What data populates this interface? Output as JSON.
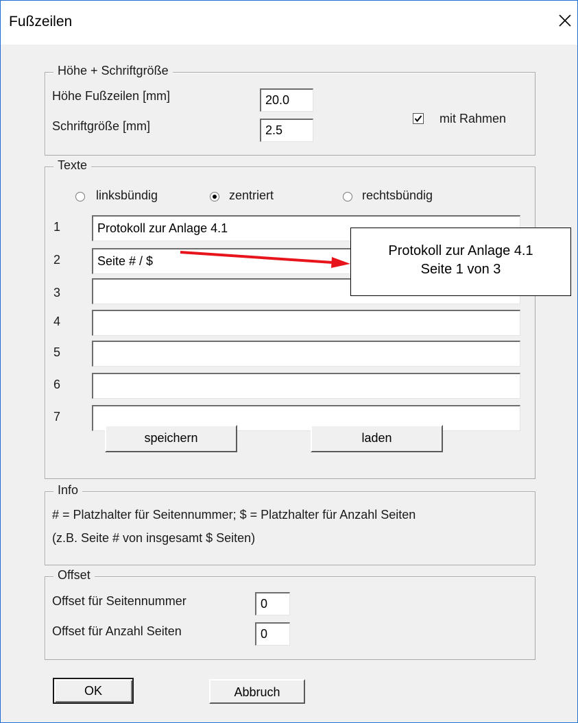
{
  "window": {
    "title": "Fußzeilen",
    "close_icon": "close-icon"
  },
  "hoehe": {
    "legend": "Höhe + Schriftgröße",
    "height_label": "Höhe Fußzeilen [mm]",
    "height_value": "20.0",
    "size_label": "Schriftgröße [mm]",
    "size_value": "2.5",
    "frame_label": "mit Rahmen",
    "frame_checked": true
  },
  "texte": {
    "legend": "Texte",
    "align_options": [
      "linksbündig",
      "zentriert",
      "rechtsbündig"
    ],
    "selected_align": "zentriert",
    "lines": [
      {
        "num": "1",
        "value": "Protokoll zur Anlage 4.1"
      },
      {
        "num": "2",
        "value": "Seite # / $"
      },
      {
        "num": "3",
        "value": ""
      },
      {
        "num": "4",
        "value": ""
      },
      {
        "num": "5",
        "value": ""
      },
      {
        "num": "6",
        "value": ""
      },
      {
        "num": "7",
        "value": ""
      }
    ],
    "save_label": "speichern",
    "load_label": "laden"
  },
  "callout": {
    "line1": "Protokoll zur Anlage 4.1",
    "line2": "Seite 1 von 3",
    "arrow_color": "#e8141b"
  },
  "info": {
    "legend": "Info",
    "line1": "# = Platzhalter für Seitennummer; $ = Platzhalter für Anzahl Seiten",
    "line2": "(z.B. Seite # von insgesamt $ Seiten)"
  },
  "offset": {
    "legend": "Offset",
    "page_label": "Offset für Seitennummer",
    "page_value": "0",
    "count_label": "Offset für Anzahl Seiten",
    "count_value": "0"
  },
  "buttons": {
    "ok": "OK",
    "cancel": "Abbruch"
  }
}
